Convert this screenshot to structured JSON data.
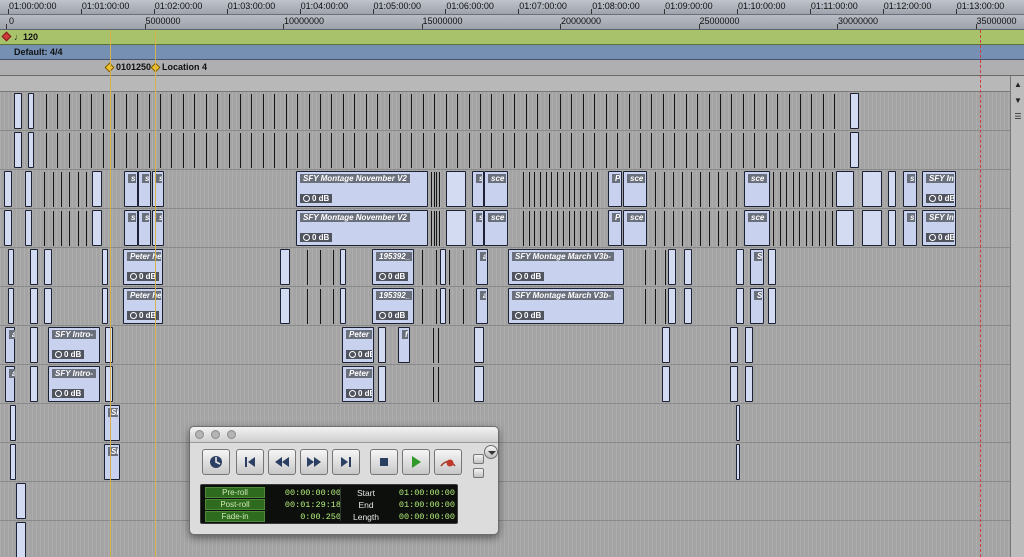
{
  "timecode_ruler": {
    "ticks": [
      "01:00:00:00",
      "01:01:00:00",
      "01:02:00:00",
      "01:03:00:00",
      "01:04:00:00",
      "01:05:00:00",
      "01:06:00:00",
      "01:07:00:00",
      "01:08:00:00",
      "01:09:00:00",
      "01:10:00:00",
      "01:11:00:00",
      "01:12:00:00",
      "01:13:00:00"
    ]
  },
  "samples_ruler": {
    "ticks": [
      "0",
      "5000000",
      "10000000",
      "15000000",
      "20000000",
      "25000000",
      "30000000",
      "35000000"
    ]
  },
  "tempo_ruler": {
    "value": "120"
  },
  "meter_ruler": {
    "value": "Default: 4/4"
  },
  "marker_ruler": {
    "markers": [
      "0101250",
      "Location 4"
    ]
  },
  "clip_gain_label": "0 dB",
  "tracks": [
    {
      "clips": []
    },
    {
      "clips": []
    },
    {
      "clips": [
        "s",
        "s",
        "s",
        "SFY Montage November V2",
        "s",
        "sce",
        "P",
        "sce",
        "sce",
        "s",
        "SFY In"
      ]
    },
    {
      "clips": [
        "s",
        "s",
        "s",
        "SFY Montage November V2",
        "s",
        "sce",
        "P",
        "sce",
        "sce",
        "s",
        "SFY In"
      ]
    },
    {
      "clips": [
        "Peter he",
        "195392_",
        "a",
        "SFY Montage March V3b-",
        "S"
      ]
    },
    {
      "clips": [
        "Peter he",
        "195392_",
        "a",
        "SFY Montage March V3b-",
        "S"
      ]
    },
    {
      "clips": [
        "a",
        "SFY Intro-",
        "Peter",
        "f"
      ]
    },
    {
      "clips": [
        "a",
        "SFY Intro-",
        "Peter"
      ]
    },
    {
      "clips": [
        "SF"
      ]
    },
    {
      "clips": [
        "SF"
      ]
    },
    {
      "clips": []
    },
    {
      "clips": []
    }
  ],
  "transport": {
    "buttons": [
      "online",
      "return-to-zero",
      "rewind",
      "fast-forward",
      "go-to-end",
      "stop",
      "play",
      "record"
    ],
    "counters": {
      "preroll_label": "Pre-roll",
      "preroll_value": "00:00:00:00",
      "postroll_label": "Post-roll",
      "postroll_value": "00:01:29:18",
      "fadein_label": "Fade-in",
      "fadein_value": "0:00.250",
      "start_label": "Start",
      "start_value": "01:00:00:00",
      "end_label": "End",
      "end_value": "01:00:00:00",
      "length_label": "Length",
      "length_value": "00:00:00:00"
    }
  },
  "colors": {
    "tempo_ruler": "#a7c26a",
    "meter_ruler": "#7690b3",
    "clip_fill": "#c8d2ee",
    "marker": "#f3c32a",
    "counter_text": "#b6f07c"
  }
}
